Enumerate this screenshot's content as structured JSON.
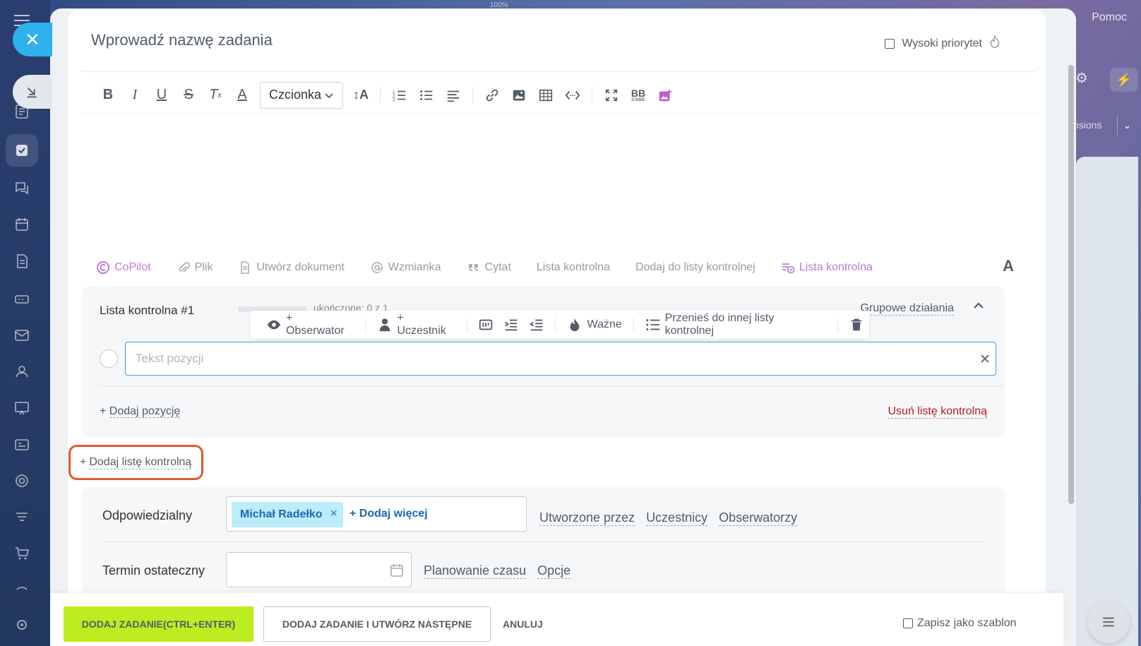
{
  "background": {
    "zoom": "100%",
    "help": "Pomoc",
    "extensions_partial": "nsions"
  },
  "task": {
    "title_placeholder": "Wprowadź nazwę zadania",
    "high_priority": "Wysoki priorytet"
  },
  "toolbar": {
    "font": "Czcionka",
    "bbcode_top": "BB",
    "bbcode_bottom": "CODE"
  },
  "attach_bar": {
    "copilot": "CoPilot",
    "file": "Plik",
    "create_document": "Utwórz dokument",
    "mention": "Wzmianka",
    "quote": "Cytat",
    "checklist": "Lista kontrolna",
    "add_to_checklist": "Dodaj do listy kontrolnej",
    "checklist_active": "Lista kontrolna",
    "font_toggle": "A"
  },
  "checklist": {
    "title": "Lista kontrolna #1",
    "completed": "ukończone: 0 z 1",
    "group_actions": "Grupowe działania",
    "item_placeholder": "Tekst pozycji",
    "add_item_prefix": "+",
    "add_item": "Dodaj pozycję",
    "remove": "Usuń listę kontrolną",
    "panel": {
      "observer": "+ Obserwator",
      "participant": "+ Uczestnik",
      "important": "Ważne",
      "move": "Przenieś do innej listy kontrolnej"
    }
  },
  "add_checklist": {
    "prefix": "+",
    "label": "Dodaj listę kontrolną"
  },
  "people": {
    "responsible_label": "Odpowiedzialny",
    "responsible_name": "Michał Radełko",
    "add_more": "+ Dodaj więcej",
    "links": [
      "Utworzone przez",
      "Uczestnicy",
      "Obserwatorzy"
    ],
    "deadline_label": "Termin ostateczny",
    "deadline_value": "",
    "date_links": [
      "Planowanie czasu",
      "Opcje"
    ]
  },
  "footer": {
    "add_task": "DODAJ ZADANIE(CTRL+ENTER)",
    "add_and_next": "DODAJ ZADANIE I UTWÓRZ NASTĘPNE",
    "cancel": "ANULUJ",
    "save_template": "Zapisz jako szablon"
  },
  "colors": {
    "accent_blue": "#2fb1f0",
    "add_button_green": "#bbed21",
    "highlight_orange": "#e05a2b",
    "copilot_purple": "#c17bd9",
    "remove_red": "#b31c1c"
  }
}
